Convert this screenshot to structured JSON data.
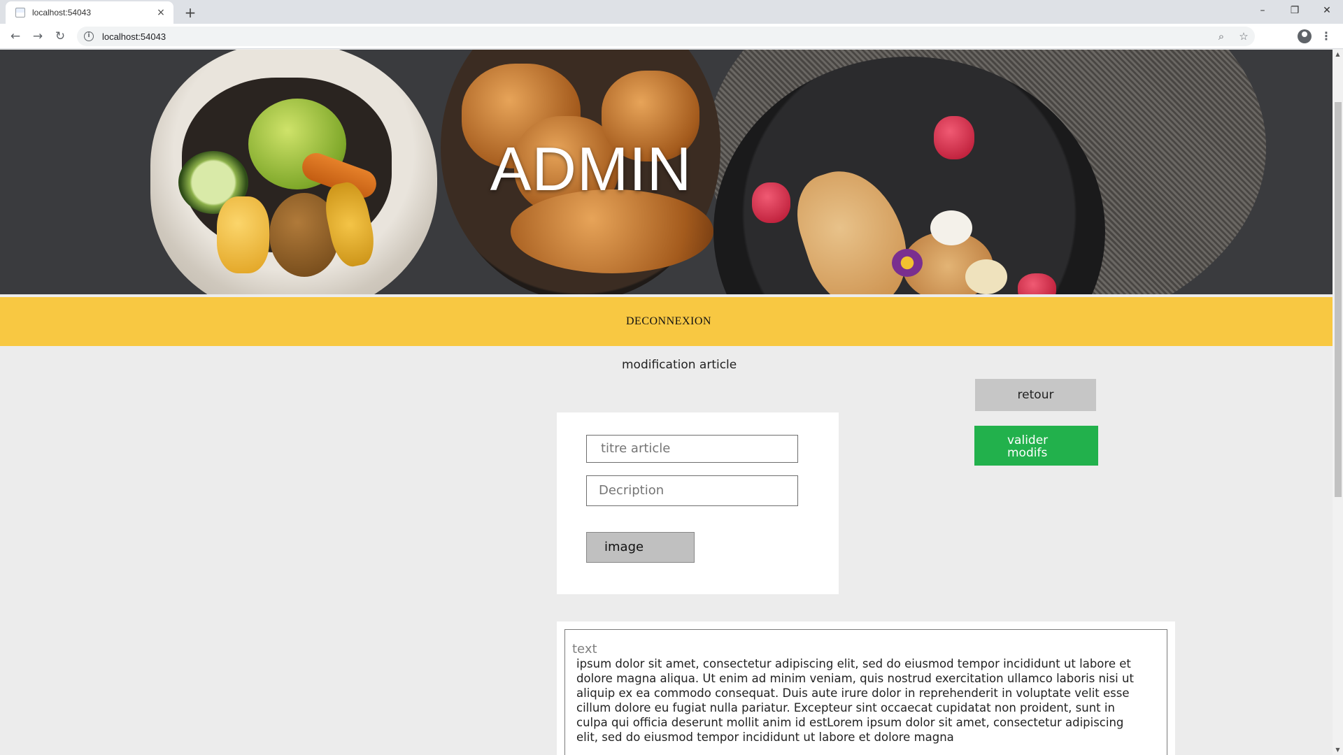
{
  "browser": {
    "tab_title": "localhost:54043",
    "new_tab_label": "+",
    "close_tab_label": "×",
    "url": "localhost:54043",
    "window_controls": {
      "minimize": "–",
      "restore": "❐",
      "close": "✕"
    },
    "nav": {
      "back": "←",
      "forward": "→",
      "reload": "↻"
    },
    "omni_icons": {
      "zoom": "⌕",
      "star": "☆"
    },
    "menu": "⋮"
  },
  "hero": {
    "title": "ADMIN"
  },
  "navbar": {
    "logout_label": "DECONNEXION"
  },
  "page": {
    "heading": "modification article"
  },
  "actions": {
    "back_label": "retour",
    "validate_label": "valider modifs",
    "validate_color": "#22b14c"
  },
  "form": {
    "title_placeholder": "titre article",
    "description_placeholder": "Decription",
    "image_button_label": "image"
  },
  "text_editor": {
    "label": "text",
    "body": " ipsum dolor sit amet, consectetur adipiscing elit, sed do eiusmod tempor incididunt ut labore et dolore magna aliqua. Ut enim ad minim veniam, quis nostrud exercitation ullamco laboris nisi ut aliquip ex ea commodo consequat. Duis aute irure dolor in reprehenderit in voluptate velit esse cillum dolore eu fugiat nulla pariatur. Excepteur sint occaecat cupidatat non proident, sunt in culpa qui officia deserunt mollit anim id estLorem ipsum dolor sit amet, consectetur adipiscing elit, sed do eiusmod tempor incididunt ut labore et dolore magna"
  },
  "colors": {
    "navbar": "#f8c842",
    "page_background": "#ececec",
    "back_button": "#c6c6c6"
  }
}
